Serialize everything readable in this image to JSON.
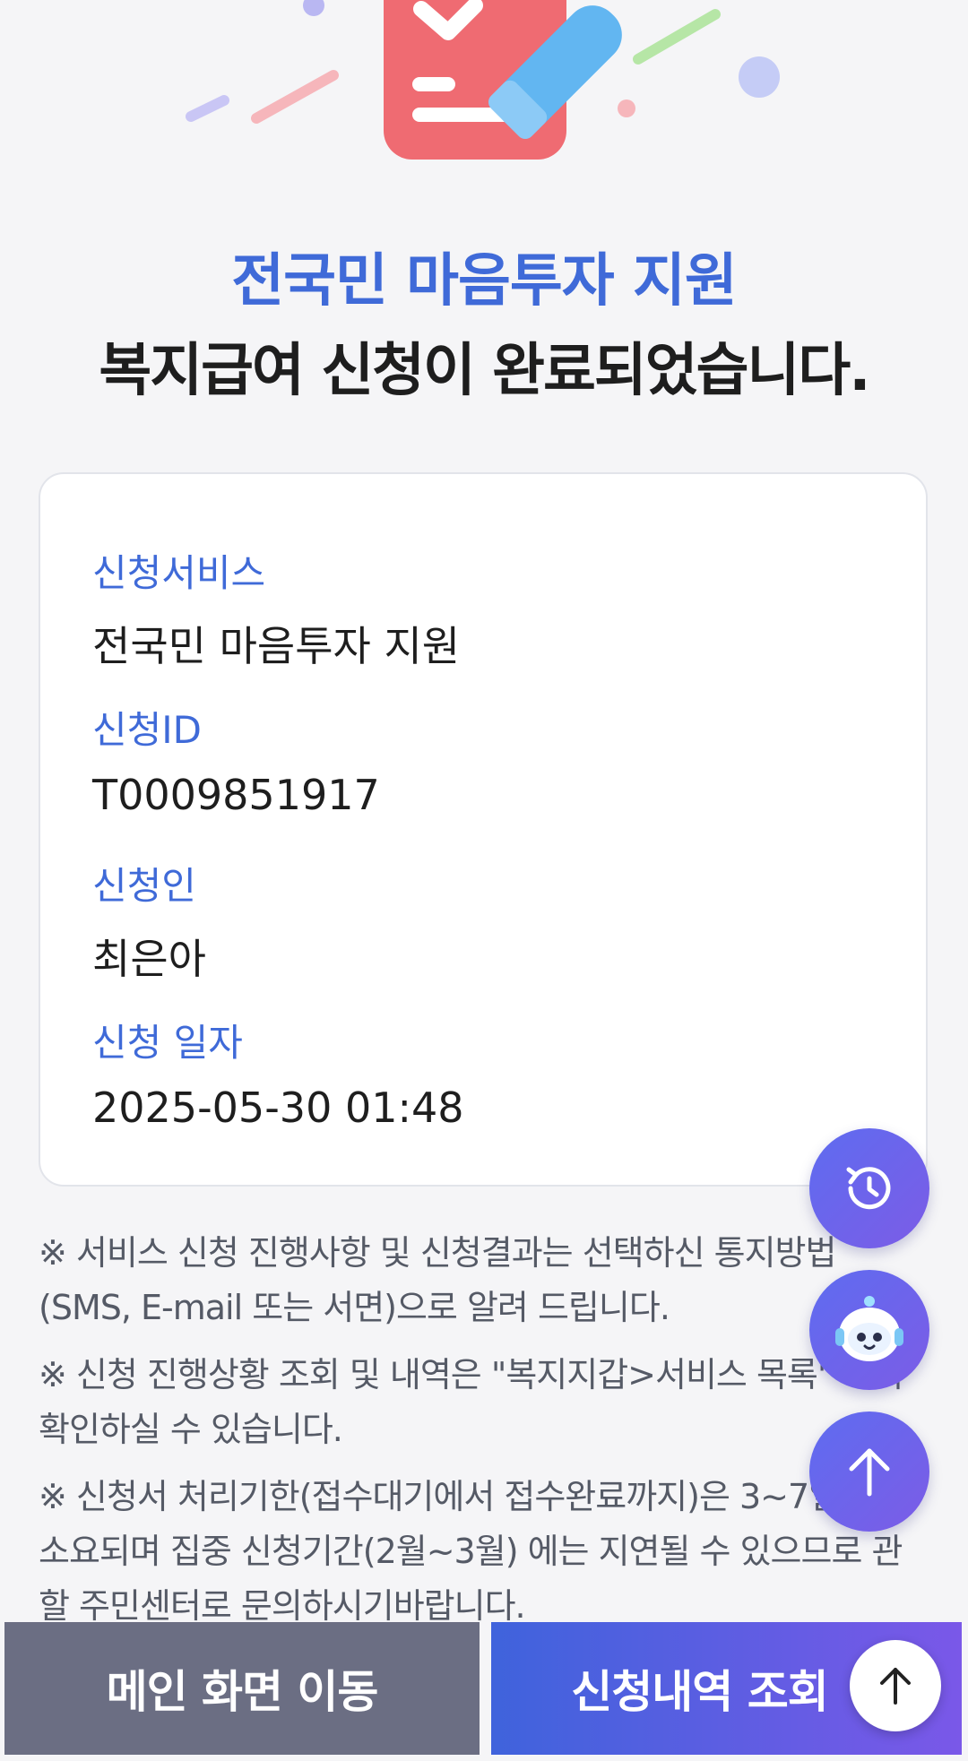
{
  "header": {
    "title_sub": "전국민 마음투자 지원",
    "title_main": "복지급여 신청이 완료되었습니다."
  },
  "details": {
    "service": {
      "label": "신청서비스",
      "value": "전국민 마음투자 지원"
    },
    "application_id": {
      "label": "신청ID",
      "value": "T0009851917"
    },
    "applicant": {
      "label": "신청인",
      "value": "최은아"
    },
    "date": {
      "label": "신청 일자",
      "value": "2025-05-30 01:48"
    }
  },
  "notices": [
    "※ 서비스 신청 진행사항 및 신청결과는 선택하신 통지방법(SMS, E-mail 또는 서면)으로 알려 드립니다.",
    "※ 신청 진행상황 조회 및 내역은 \"복지지갑>서비스 목록\" 에서 확인하실 수 있습니다.",
    "※ 신청서 처리기한(접수대기에서 접수완료까지)은 3~7일 정도 소요되며 집중 신청기간(2월~3월) 에는 지연될 수 있으므로 관할 주민센터로 문의하시기바랍니다."
  ],
  "floating_buttons": {
    "history_icon": "history-icon",
    "chatbot_icon": "chatbot-icon",
    "scroll_top_icon": "arrow-up-icon"
  },
  "bottom_bar": {
    "main_label": "메인 화면 이동",
    "history_label": "신청내역 조회"
  },
  "colors": {
    "accent": "#3f6ad8",
    "main_button": "#6b6e83",
    "history_button_start": "#3f63dc",
    "history_button_end": "#7a58e8"
  }
}
